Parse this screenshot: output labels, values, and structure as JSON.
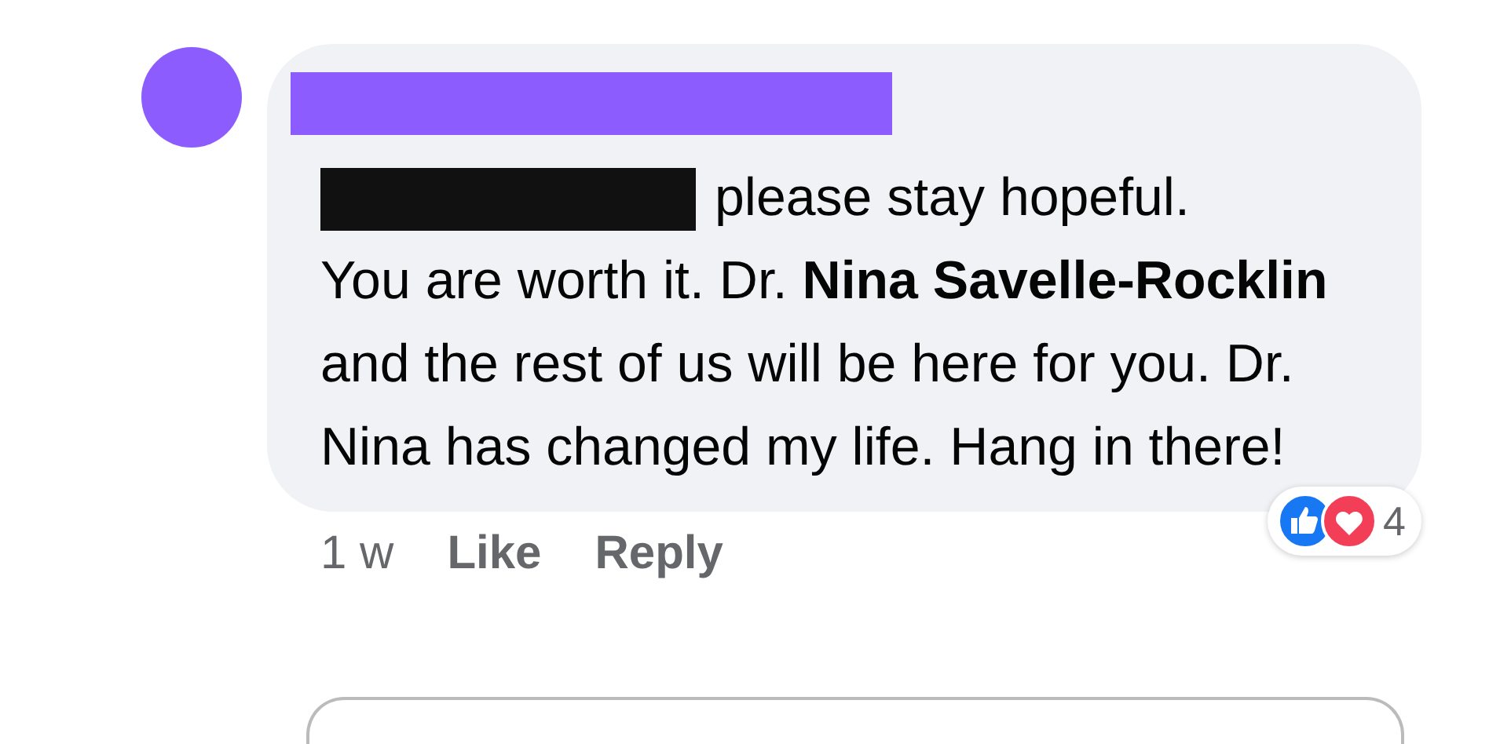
{
  "comment": {
    "intro": "please stay hopeful.",
    "text": "You are worth it. Dr. **Nina Savelle-Rocklin** and the rest of us will be here for you. Dr. Nina has changed my life. Hang in there!",
    "time": "1 w",
    "actions": [
      "Like",
      "Reply"
    ],
    "reactions": {
      "items": [
        {
          "kind": "like"
        },
        {
          "kind": "love"
        }
      ],
      "count": "4"
    }
  }
}
